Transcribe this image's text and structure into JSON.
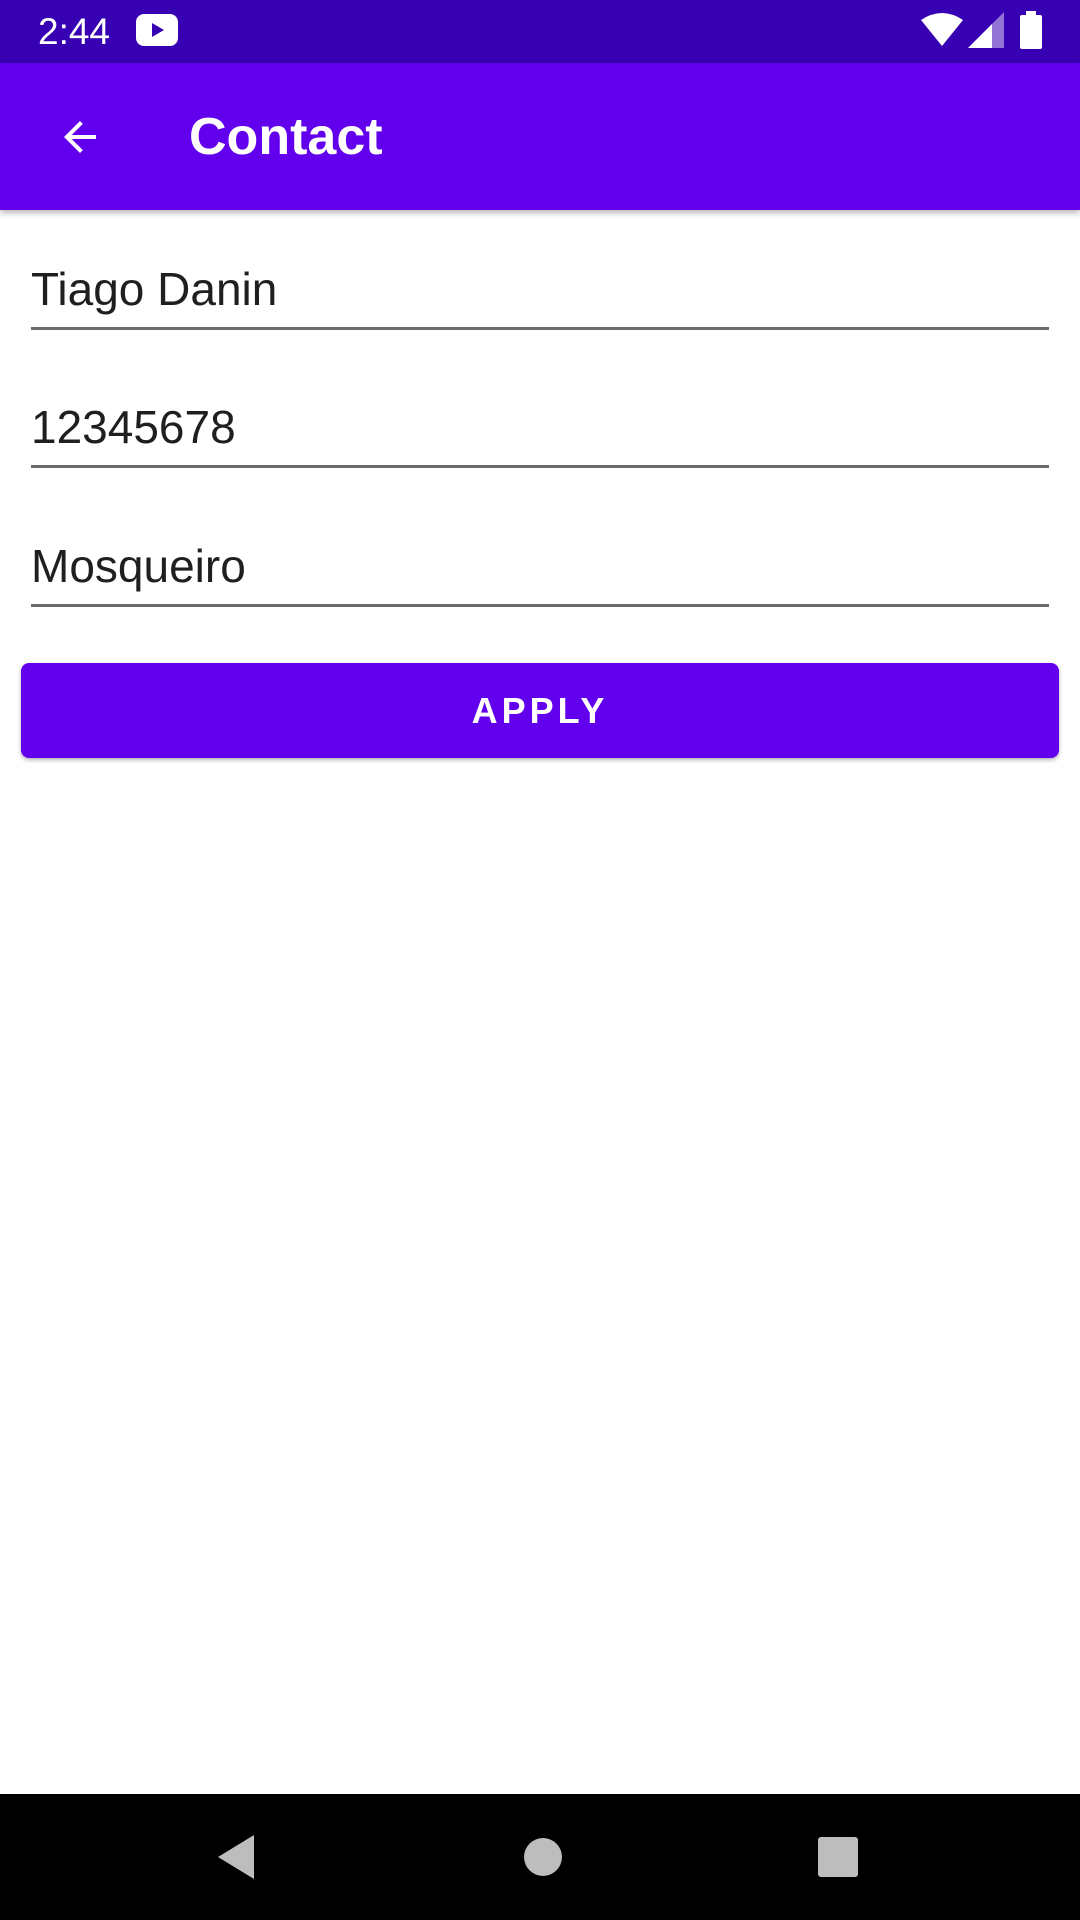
{
  "status_bar": {
    "time": "2:44",
    "icons": [
      "youtube-icon",
      "wifi-icon",
      "signal-icon",
      "battery-icon"
    ]
  },
  "app_bar": {
    "title": "Contact",
    "back_icon": "arrow-back-icon"
  },
  "form": {
    "name_value": "Tiago Danin",
    "phone_value": "12345678",
    "address_value": "Mosqueiro",
    "apply_label": "APPLY"
  },
  "nav_bar": {
    "icons": [
      "back-triangle-icon",
      "home-circle-icon",
      "recents-square-icon"
    ]
  },
  "colors": {
    "status_bar": "#3700b3",
    "primary": "#6200ee",
    "field_underline": "#6b6b6b",
    "text": "#1f1f1f"
  }
}
